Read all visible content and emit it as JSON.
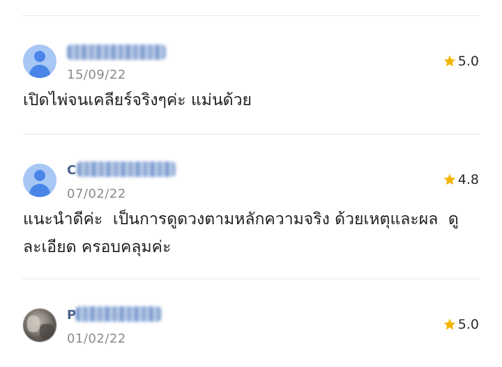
{
  "reviews": [
    {
      "name_initial": "",
      "date": "15/09/22",
      "rating": "5.0",
      "comment": "เปิดไพ่จนเคลียร์จริงๆค่ะ แม่นด้วย",
      "avatar": "default-user-icon"
    },
    {
      "name_initial": "C",
      "date": "07/02/22",
      "rating": "4.8",
      "comment": "แนะนำดีค่ะ  เป็นการดูดวงตามหลักความจริง ด้วยเหตุและผล  ดูละเอียด ครอบคลุมค่ะ",
      "avatar": "default-user-icon"
    },
    {
      "name_initial": "P",
      "date": "01/02/22",
      "rating": "5.0",
      "comment": "",
      "avatar": "photo"
    }
  ],
  "colors": {
    "star": "#f4b400",
    "avatar_bg": "#a9c7f5",
    "avatar_fg": "#4a86e8",
    "date": "#8a8a8a",
    "divider": "#e6e6e6"
  }
}
